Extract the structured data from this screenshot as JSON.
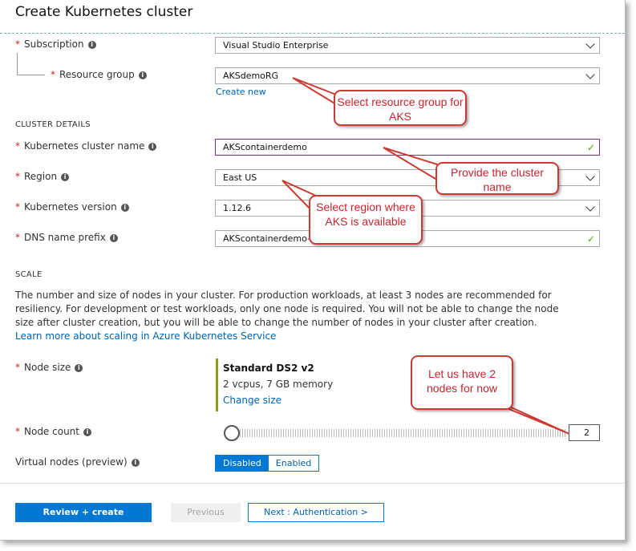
{
  "header": {
    "title": "Create Kubernetes cluster"
  },
  "basics": {
    "subscription_label": "Subscription",
    "subscription_value": "Visual Studio Enterprise",
    "resource_group_label": "Resource group",
    "resource_group_value": "AKSdemoRG",
    "create_new_link": "Create new"
  },
  "cluster_details": {
    "heading": "CLUSTER DETAILS",
    "cluster_name_label": "Kubernetes cluster name",
    "cluster_name_value": "AKScontainerdemo",
    "region_label": "Region",
    "region_value": "East US",
    "version_label": "Kubernetes version",
    "version_value": "1.12.6",
    "dns_label": "DNS name prefix",
    "dns_value": "AKScontainerdemo-dns"
  },
  "scale": {
    "heading": "SCALE",
    "description": "The number and size of nodes in your cluster. For production workloads, at least 3 nodes are recommended for resiliency. For development or test workloads, only one node is required. You will not be able to change the node size after cluster creation, but you will be able to change the number of nodes in your cluster after creation.",
    "learn_more_link": "Learn more about scaling in Azure Kubernetes Service",
    "node_size_label": "Node size",
    "node_size_name": "Standard DS2 v2",
    "node_size_specs": "2 vcpus, 7 GB memory",
    "change_size_link": "Change size",
    "node_count_label": "Node count",
    "node_count_value": "2",
    "virtual_nodes_label": "Virtual nodes (preview)",
    "virtual_nodes_options": [
      "Disabled",
      "Enabled"
    ],
    "virtual_nodes_selected": "Disabled"
  },
  "footer": {
    "review_create": "Review + create",
    "previous": "Previous",
    "next": "Next : Authentication >"
  },
  "annotations": {
    "resource_group": "Select resource group for AKS",
    "cluster_name": "Provide the cluster name",
    "region": "Select region where AKS is available",
    "node_count": "Let us have 2 nodes for now"
  },
  "colors": {
    "accent": "#0078d4",
    "required": "#c4262e",
    "callout_border": "#cc3b33",
    "valid_check": "#57a300"
  },
  "icons": {
    "info": "info-icon",
    "dropdown": "chevron-down-icon",
    "valid": "checkmark-icon"
  }
}
